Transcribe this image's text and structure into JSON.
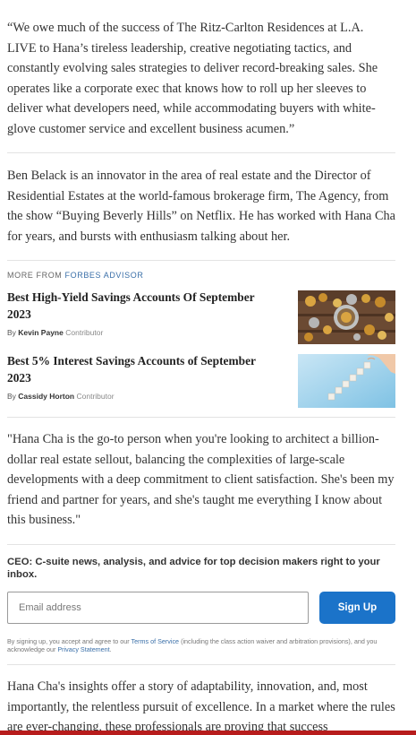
{
  "quote1": "“We owe much of the success of The Ritz-Carlton Residences at L.A. LIVE to Hana’s tireless leadership, creative negotiating tactics, and constantly evolving sales strategies to deliver record-breaking sales. She operates like a corporate exec that knows how to roll up her sleeves to deliver what developers need, while accommodating buyers with white-glove customer service and excellent business acumen.”",
  "para_ben": "Ben Belack is an innovator in the area of real estate and the Director of Residential Estates at the world-famous brokerage firm, The Agency, from the show “Buying Beverly Hills” on Netflix. He has worked with Hana Cha for years, and bursts with enthusiasm talking about her.",
  "more_from": {
    "prefix": "MORE FROM",
    "brand": "FORBES ADVISOR"
  },
  "recommendations": [
    {
      "title": "Best High-Yield Savings Accounts Of September 2023",
      "by": "By",
      "author": "Kevin Payne",
      "role": "Contributor",
      "thumb_icon": "coins-photo-icon"
    },
    {
      "title": "Best 5% Interest Savings Accounts of September 2023",
      "by": "By",
      "author": "Cassidy Horton",
      "role": "Contributor",
      "thumb_icon": "stairs-blocks-photo-icon"
    }
  ],
  "quote2": "\"Hana Cha is the go-to person when you're looking to architect a billion-dollar real estate sellout, balancing the complexities of large-scale developments with a deep commitment to client satisfaction. She's been my friend and partner for years, and she's taught me everything I know about this business.\"",
  "newsletter": {
    "title": "CEO: C-suite news, analysis, and advice for top decision makers right to your inbox.",
    "email_placeholder": "Email address",
    "signup_label": "Sign Up",
    "disclaimer_start": "By signing up, you accept and agree to our",
    "terms_link": "Terms of Service",
    "disclaimer_mid": "(including the class action waiver and arbitration provisions), and you acknowledge our",
    "privacy_link": "Privacy Statement",
    "disclaimer_end": "."
  },
  "para_final": "Hana Cha's insights offer a story of adaptability, innovation, and, most importantly, the relentless pursuit of excellence. In a market where the rules are ever-changing, these professionals are proving that success",
  "colors": {
    "accent_blue": "#1b73c9",
    "link_blue": "#3a6fa8",
    "bottom_bar": "#b71c1c"
  }
}
